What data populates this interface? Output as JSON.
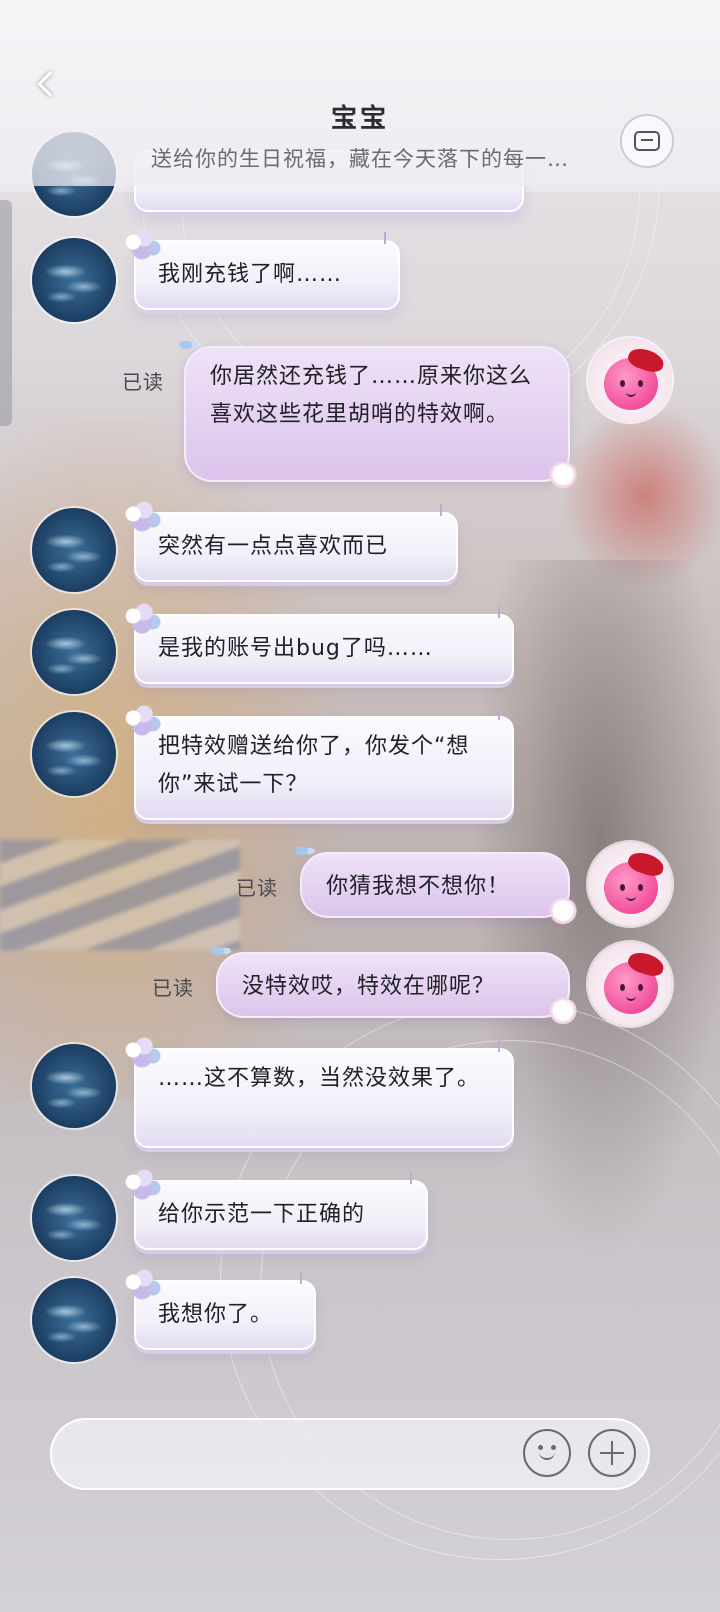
{
  "header": {
    "back_icon": "chevron-left-icon",
    "title": "宝宝",
    "subtitle": "送给你的生日祝福，藏在今天落下的每一…",
    "chat_icon": "chat-bubble-icon"
  },
  "messages": [
    {
      "side": "in",
      "text": "我刚充钱了啊……"
    },
    {
      "side": "out",
      "status": "已读",
      "text": "你居然还充钱了……原来你这么喜欢这些花里胡哨的特效啊。"
    },
    {
      "side": "in",
      "text": "突然有一点点喜欢而已"
    },
    {
      "side": "in",
      "text": "是我的账号出bug了吗……"
    },
    {
      "side": "in",
      "text": "把特效赠送给你了，你发个“想你”来试一下？"
    },
    {
      "side": "out",
      "status": "已读",
      "text": "你猜我想不想你！"
    },
    {
      "side": "out",
      "status": "已读",
      "text": "没特效哎，特效在哪呢？"
    },
    {
      "side": "in",
      "text": "……这不算数，当然没效果了。"
    },
    {
      "side": "in",
      "text": "给你示范一下正确的"
    },
    {
      "side": "in",
      "text": "我想你了。"
    }
  ],
  "input": {
    "emoji_icon": "emoji-icon",
    "plus_icon": "plus-icon"
  },
  "colors": {
    "bubble_in": "#f1eef8",
    "bubble_out": "#dcc4ec",
    "text": "#202027",
    "read_status": "#4a4850"
  }
}
